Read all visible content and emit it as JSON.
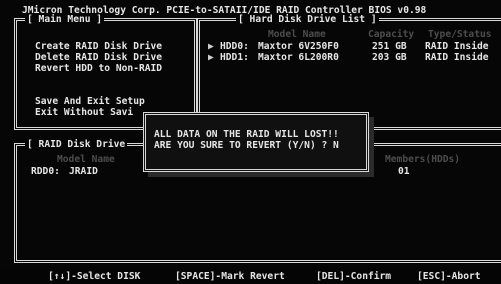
{
  "header": {
    "title": "JMicron Technology Corp. PCIE-to-SATAII/IDE RAID Controller BIOS v0.98"
  },
  "main_menu": {
    "title": "[ Main Menu ]",
    "items": [
      {
        "label": "Create RAID Disk Drive"
      },
      {
        "label": "Delete RAID Disk Drive"
      },
      {
        "label": "Revert HDD to Non-RAID"
      },
      {
        "label": "Save And Exit Setup"
      },
      {
        "label": "Exit Without Savi"
      }
    ]
  },
  "hdd_list": {
    "title": "[ Hard Disk Drive List ]",
    "columns": {
      "model": "Model Name",
      "capacity": "Capacity",
      "type": "Type/Status"
    },
    "rows": [
      {
        "marker": "▶",
        "id": "HDD0:",
        "model": "Maxtor 6V250F0",
        "capacity": "251 GB",
        "type": "RAID Inside"
      },
      {
        "marker": "▶",
        "id": "HDD1:",
        "model": "Maxtor 6L200R0",
        "capacity": "203 GB",
        "type": "RAID Inside"
      }
    ]
  },
  "raid_list": {
    "title": "[ RAID Disk Drive",
    "columns": {
      "model": "Model Name",
      "members": "Members(HDDs)"
    },
    "rows": [
      {
        "id": "RDD0:",
        "name": "JRAID",
        "members": "01"
      }
    ]
  },
  "dialog": {
    "line1": "ALL DATA ON THE RAID WILL LOST!!",
    "line2": "ARE YOU SURE TO REVERT (Y/N) ? N"
  },
  "footer": {
    "keys": [
      {
        "label": "[↑↓]-Select DISK"
      },
      {
        "label": "[SPACE]-Mark Revert"
      },
      {
        "label": "[DEL]-Confirm"
      },
      {
        "label": "[ESC]-Abort"
      }
    ]
  }
}
